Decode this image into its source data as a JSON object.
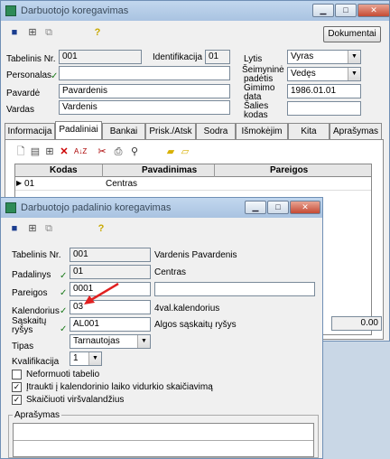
{
  "main_window": {
    "title": "Darbuotojo koregavimas",
    "document_button": "Dokumentai",
    "fields": {
      "tabelinis_label": "Tabelinis Nr.",
      "tabelinis_value": "001",
      "identifikacija_label": "Identifikacija",
      "identifikacija_value": "01",
      "personalas_label": "Personalas",
      "personalas_value": "",
      "pavarde_label": "Pavardė",
      "pavarde_value": "Pavardenis",
      "vardas_label": "Vardas",
      "vardas_value": "Vardenis",
      "lytis_label": "Lytis",
      "lytis_value": "Vyras",
      "seimynine_label_1": "Šeimyninė",
      "seimynine_label_2": "padėtis",
      "seimynine_value": "Vedęs",
      "gimimo_label_1": "Gimimo",
      "gimimo_label_2": "data",
      "gimimo_value": "1986.01.01",
      "salies_label_1": "Šalies",
      "salies_label_2": "kodas",
      "salies_value": ""
    },
    "tabs": [
      "Informacija",
      "Padaliniai",
      "Bankai",
      "Prisk./Atsk",
      "Sodra",
      "Išmokėjim",
      "Kita",
      "Aprašymas"
    ],
    "table": {
      "headers": [
        "Kodas",
        "Pavadinimas",
        "Pareigos"
      ],
      "rows": [
        {
          "kodas": "01",
          "pavadinimas": "Centras",
          "pareigos": ""
        }
      ]
    },
    "bottom_value": "0.00"
  },
  "dialog": {
    "title": "Darbuotojo padalinio koregavimas",
    "tabelinis_label": "Tabelinis Nr.",
    "tabelinis_value": "001",
    "tabelinis_name": "Vardenis Pavardenis",
    "padalinys_label": "Padalinys",
    "padalinys_value": "01",
    "padalinys_name": "Centras",
    "pareigos_label": "Pareigos",
    "pareigos_value": "0001",
    "pareigos_extra": "",
    "kalendorius_label": "Kalendorius",
    "kalendorius_value": "03",
    "kalendorius_name": "4val.kalendorius",
    "saskaitu_label_1": "Sąskaitų",
    "saskaitu_label_2": "ryšys",
    "saskaitu_value": "AL001",
    "saskaitu_name": "Algos sąskaitų ryšys",
    "tipas_label": "Tipas",
    "tipas_value": "Tarnautojas",
    "kvalifikacija_label": "Kvalifikacija",
    "kvalifikacija_value": "1",
    "checkboxes": [
      {
        "label": "Neformuoti tabelio",
        "checked": false
      },
      {
        "label": "Įtraukti į kalendorinio laiko vidurkio skaičiavimą",
        "checked": true
      },
      {
        "label": "Skaičiuoti viršvalandžius",
        "checked": true
      }
    ],
    "aprasymas_label": "Aprašymas"
  },
  "colors": {
    "title_bar": "#b5cce6",
    "check_green": "#1b7a1b",
    "arrow_red": "#e02020"
  }
}
